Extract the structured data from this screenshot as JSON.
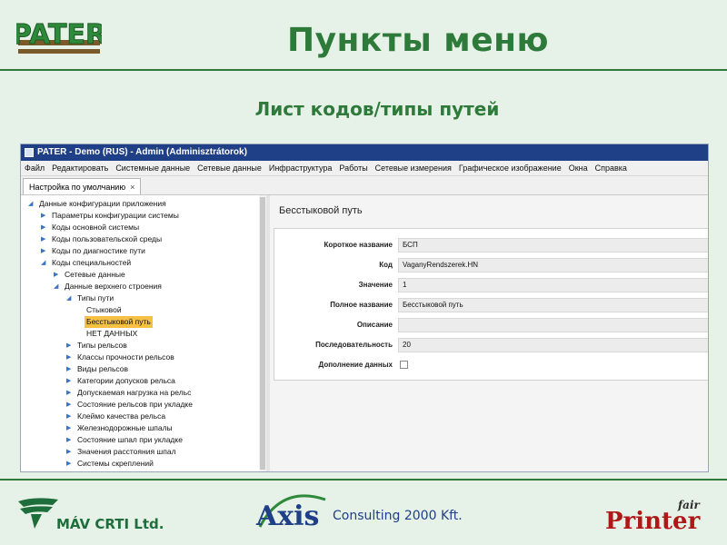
{
  "slide": {
    "title": "Пункты меню",
    "subtitle": "Лист кодов/типы путей",
    "logo_left_text": "PATER"
  },
  "window": {
    "title": "PATER - Demo (RUS) - Admin (Adminisztrátorok)",
    "menu": [
      "Файл",
      "Редактировать",
      "Системные данные",
      "Сетевые данные",
      "Инфраструктура",
      "Работы",
      "Сетевые измерения",
      "Графическое изображение",
      "Окна",
      "Справка"
    ],
    "tab_label": "Настройка по умолчанию",
    "tab_close": "×"
  },
  "tree": [
    {
      "label": "Данные конфигурации приложения",
      "level": 0,
      "arrow": "expanded"
    },
    {
      "label": "Параметры конфигурации системы",
      "level": 1,
      "arrow": "collapsed"
    },
    {
      "label": "Коды основной системы",
      "level": 1,
      "arrow": "collapsed"
    },
    {
      "label": "Коды пользовательской среды",
      "level": 1,
      "arrow": "collapsed"
    },
    {
      "label": "Коды по диагностике пути",
      "level": 1,
      "arrow": "collapsed"
    },
    {
      "label": "Коды специальностей",
      "level": 1,
      "arrow": "expanded"
    },
    {
      "label": "Сетевые данные",
      "level": 2,
      "arrow": "collapsed"
    },
    {
      "label": "Данные верхнего строения",
      "level": 2,
      "arrow": "expanded"
    },
    {
      "label": "Типы пути",
      "level": 3,
      "arrow": "expanded"
    },
    {
      "label": "Стыковой",
      "level": 4,
      "arrow": "none"
    },
    {
      "label": "Бесстыковой путь",
      "level": 4,
      "arrow": "none",
      "selected": true
    },
    {
      "label": "НЕТ ДАННЫХ",
      "level": 4,
      "arrow": "none"
    },
    {
      "label": "Типы рельсов",
      "level": 3,
      "arrow": "collapsed"
    },
    {
      "label": "Классы прочности рельсов",
      "level": 3,
      "arrow": "collapsed"
    },
    {
      "label": "Виды рельсов",
      "level": 3,
      "arrow": "collapsed"
    },
    {
      "label": "Категории допусков рельса",
      "level": 3,
      "arrow": "collapsed"
    },
    {
      "label": "Допускаемая нагрузка на рельс",
      "level": 3,
      "arrow": "collapsed"
    },
    {
      "label": "Состояние рельсов при укладке",
      "level": 3,
      "arrow": "collapsed"
    },
    {
      "label": "Клеймо качества рельса",
      "level": 3,
      "arrow": "collapsed"
    },
    {
      "label": "Железнодорожные шпалы",
      "level": 3,
      "arrow": "collapsed"
    },
    {
      "label": "Состояние шпал при укладке",
      "level": 3,
      "arrow": "collapsed"
    },
    {
      "label": "Значения расстояния шпал",
      "level": 3,
      "arrow": "collapsed"
    },
    {
      "label": "Системы скреплений",
      "level": 3,
      "arrow": "collapsed"
    }
  ],
  "details": {
    "title": "Бесстыковой путь",
    "fields": [
      {
        "label": "Короткое название",
        "value": "БСП"
      },
      {
        "label": "Код",
        "value": "VaganyRendszerek.HN"
      },
      {
        "label": "Значение",
        "value": "1"
      },
      {
        "label": "Полное название",
        "value": "Бесстыковой путь"
      },
      {
        "label": "Описание",
        "value": ""
      },
      {
        "label": "Последовательность",
        "value": "20"
      },
      {
        "label": "Дополнение данных",
        "value": "",
        "type": "checkbox",
        "checked": false
      }
    ]
  },
  "footer": {
    "mav_text": "MÁV CRTI Ltd.",
    "axis_text": "Axis",
    "consulting_text": "Consulting 2000 Kft.",
    "printer_text": "Printer",
    "printer_fair_text": "fair"
  },
  "colors": {
    "slide_green": "#2e7a3a",
    "background": "#e6f1e7",
    "titlebar": "#1f3f86",
    "selected": "#f5c043"
  }
}
